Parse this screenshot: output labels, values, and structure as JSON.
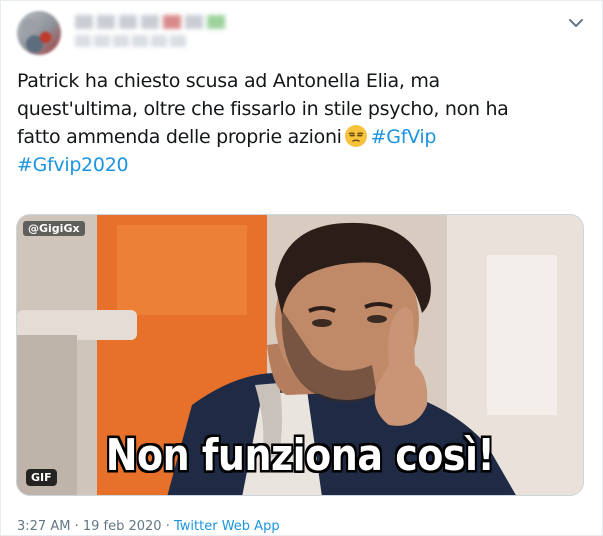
{
  "tweet": {
    "text_lines": [
      "Patrick ha chiesto scusa ad Antonella Elia, ma",
      "quest'ultima, oltre che fissarlo in stile psycho, non ha",
      "fatto ammenda delle proprie azioni"
    ],
    "hashtags": [
      "#GfVip",
      "#Gfvip2020"
    ],
    "emoji_icon": "unamused-face-emoji"
  },
  "media": {
    "watermark": "@GigiGx",
    "subtitle": "Non funziona così!",
    "badge": "GIF"
  },
  "footer": {
    "time": "3:27 AM",
    "separator": "·",
    "date": "19 feb 2020",
    "source": "Twitter Web App"
  },
  "colors": {
    "text": "#14171a",
    "link": "#1b95e0",
    "meta": "#657786"
  }
}
